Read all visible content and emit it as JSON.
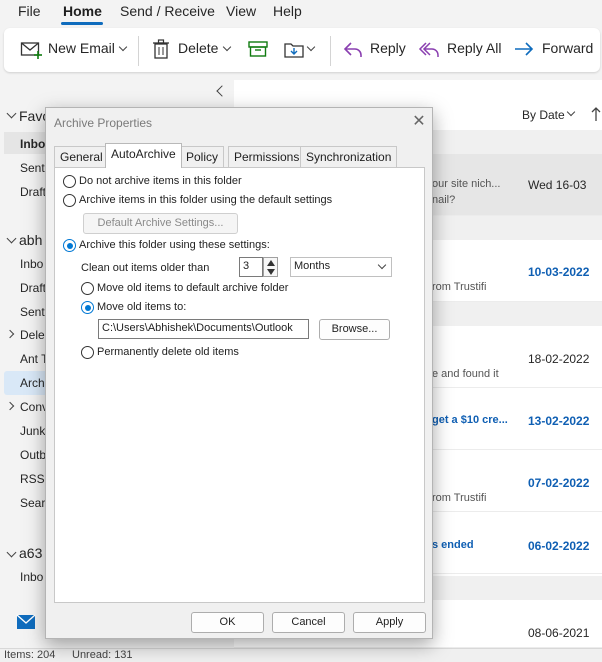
{
  "menu": {
    "file": "File",
    "home": "Home",
    "send_receive": "Send / Receive",
    "view": "View",
    "help": "Help"
  },
  "ribbon": {
    "new_email": "New Email",
    "delete": "Delete",
    "reply": "Reply",
    "reply_all": "Reply All",
    "forward": "Forward"
  },
  "nav": {
    "favorites": "Favo",
    "inbox": "Inbo",
    "sent": "Sent",
    "drafts": "Draft",
    "account1": "abh",
    "inbox2": "Inbo",
    "drafts2": "Draft",
    "sent2": "Sent",
    "deleted": "Dele",
    "ant": "Ant T",
    "archive": "Arch",
    "conv": "Conv",
    "junk": "Junk",
    "outbox": "Outb",
    "rss": "RSS F",
    "search": "Searc",
    "account2": "a63",
    "inbox3": "Inbo"
  },
  "list": {
    "sort": "By Date",
    "rows": [
      {
        "preview": "our site nich...",
        "preview2": "nail?",
        "date": "Wed 16-03"
      },
      {
        "preview": "rom Trustifi",
        "date": "10-03-2022"
      },
      {
        "preview": "e and found it",
        "date": "18-02-2022"
      },
      {
        "preview": "get a $10 cre...",
        "date": "13-02-2022"
      },
      {
        "preview": "rom Trustifi",
        "date": "07-02-2022"
      },
      {
        "preview": "s ended",
        "date": "06-02-2022"
      },
      {
        "date": "08-06-2021"
      }
    ]
  },
  "status": {
    "items": "Items: 204",
    "unread": "Unread: 131"
  },
  "dialog": {
    "title": "Archive Properties",
    "tabs": [
      "General",
      "AutoArchive",
      "Policy",
      "Permissions",
      "Synchronization"
    ],
    "opt_no_archive": "Do not archive items in this folder",
    "opt_default": "Archive items in this folder using the default settings",
    "default_settings_btn": "Default Archive Settings...",
    "opt_these": "Archive this folder using these settings:",
    "clean_label": "Clean out items older than",
    "clean_value": "3",
    "clean_unit": "Months",
    "opt_move_default": "Move old items to default archive folder",
    "opt_move_to": "Move old items to:",
    "path": "C:\\Users\\Abhishek\\Documents\\Outlook",
    "browse": "Browse...",
    "opt_delete": "Permanently delete old items",
    "ok": "OK",
    "cancel": "Cancel",
    "apply": "Apply"
  },
  "colors": {
    "accent": "#0078d4",
    "link": "#0f5fb3",
    "tab_underline": "#0f6cbd"
  }
}
